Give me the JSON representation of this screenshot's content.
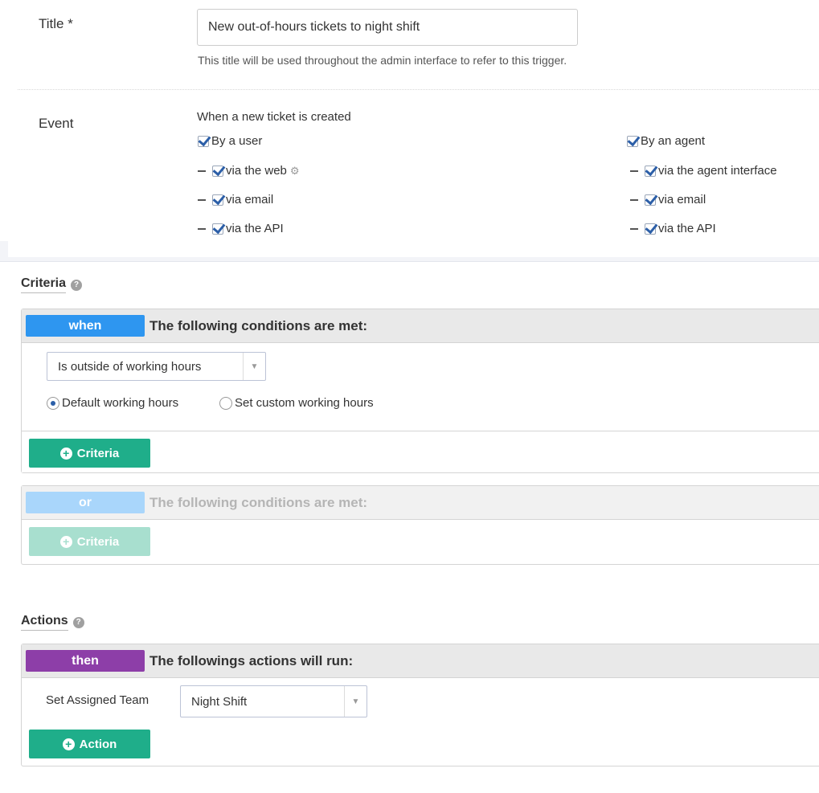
{
  "title_field": {
    "label": "Title *",
    "value": "New out-of-hours tickets to night shift",
    "help": "This title will be used throughout the admin interface to refer to this trigger."
  },
  "event": {
    "label": "Event",
    "heading": "When a new ticket is created",
    "user": {
      "label": "By a user",
      "checked": true,
      "items": [
        {
          "label": "via the web",
          "checked": true,
          "icon": "gear-icon"
        },
        {
          "label": "via email",
          "checked": true
        },
        {
          "label": "via the API",
          "checked": true
        }
      ]
    },
    "agent": {
      "label": "By an agent",
      "checked": true,
      "items": [
        {
          "label": "via the agent interface",
          "checked": true
        },
        {
          "label": "via email",
          "checked": true
        },
        {
          "label": "via the API",
          "checked": true
        }
      ]
    }
  },
  "criteria": {
    "section_title": "Criteria",
    "when_block": {
      "tag": "when",
      "heading": "The following conditions are met:",
      "condition_select": "Is outside of working hours",
      "radio_default": "Default working hours",
      "radio_custom": "Set custom working hours",
      "selected_radio": "default",
      "add_button": "Criteria"
    },
    "or_block": {
      "tag": "or",
      "heading": "The following conditions are met:",
      "add_button": "Criteria"
    }
  },
  "actions": {
    "section_title": "Actions",
    "then_block": {
      "tag": "then",
      "heading": "The followings actions will run:",
      "action_label": "Set Assigned Team",
      "action_value": "Night Shift",
      "add_button": "Action"
    }
  },
  "colors": {
    "when": "#2e96f0",
    "or": "#a9d6fb",
    "then": "#8d3ea8",
    "green": "#1fae8a",
    "green_disabled": "#a8dfcf"
  }
}
